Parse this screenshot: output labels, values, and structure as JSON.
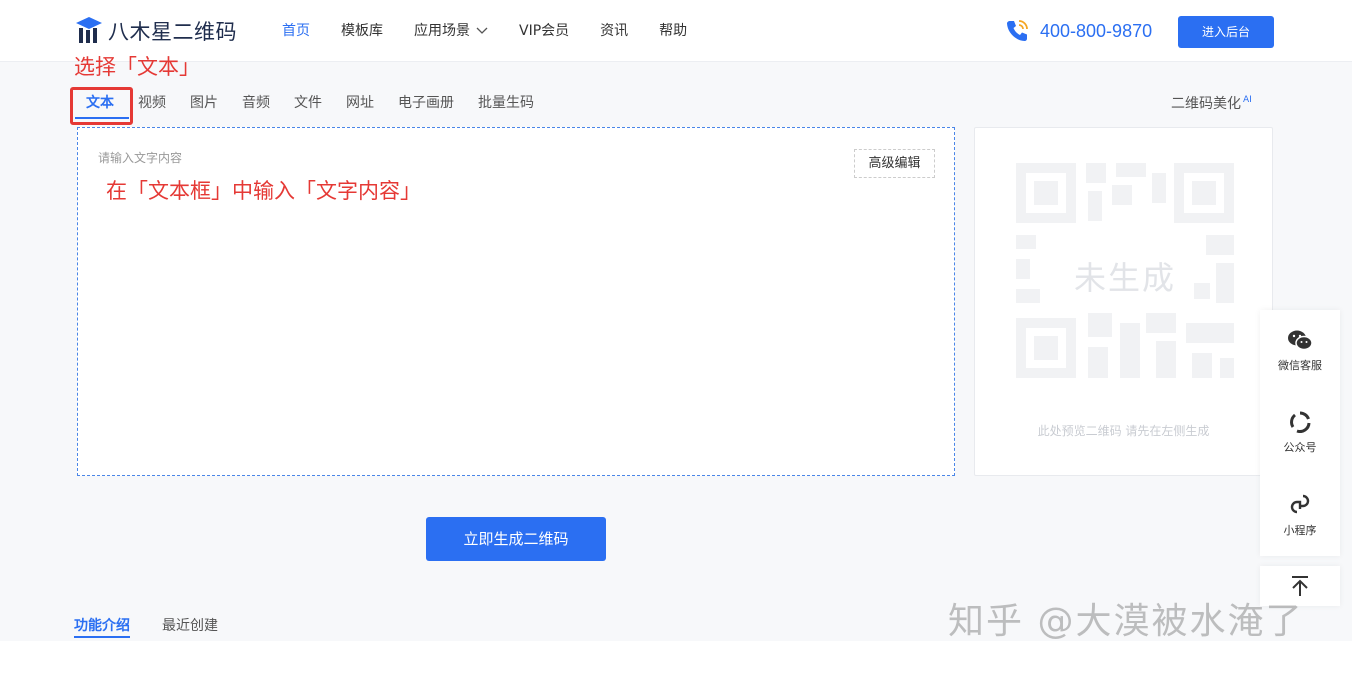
{
  "header": {
    "logo_text": "八木星二维码",
    "nav": [
      {
        "label": "首页",
        "active": true
      },
      {
        "label": "模板库",
        "active": false
      },
      {
        "label": "应用场景",
        "active": false,
        "dropdown": true
      },
      {
        "label": "VIP会员",
        "active": false
      },
      {
        "label": "资讯",
        "active": false
      },
      {
        "label": "帮助",
        "active": false
      }
    ],
    "phone": "400-800-9870",
    "enter_label": "进入后台"
  },
  "annotations": {
    "top": "选择「文本」",
    "mid": "在「文本框」中输入「文字内容」"
  },
  "tabs": [
    {
      "label": "文本",
      "active": true
    },
    {
      "label": "视频"
    },
    {
      "label": "图片"
    },
    {
      "label": "音频"
    },
    {
      "label": "文件"
    },
    {
      "label": "网址"
    },
    {
      "label": "电子画册"
    },
    {
      "label": "批量生码"
    }
  ],
  "beautify": {
    "label": "二维码美化",
    "badge": "AI"
  },
  "editor": {
    "placeholder": "请输入文字内容",
    "advanced_label": "高级编辑"
  },
  "preview": {
    "status": "未生成",
    "hint": "此处预览二维码 请先在左侧生成"
  },
  "side": {
    "items": [
      {
        "label": "微信客服",
        "icon": "wechat-icon"
      },
      {
        "label": "公众号",
        "icon": "official-account-icon"
      },
      {
        "label": "小程序",
        "icon": "mini-program-icon"
      }
    ]
  },
  "generate_label": "立即生成二维码",
  "bottom_tabs": [
    {
      "label": "功能介绍",
      "active": true
    },
    {
      "label": "最近创建",
      "active": false
    }
  ],
  "watermark": "知乎 @大漠被水淹了",
  "colors": {
    "accent": "#2b6ff2",
    "annotation": "#e53935"
  }
}
